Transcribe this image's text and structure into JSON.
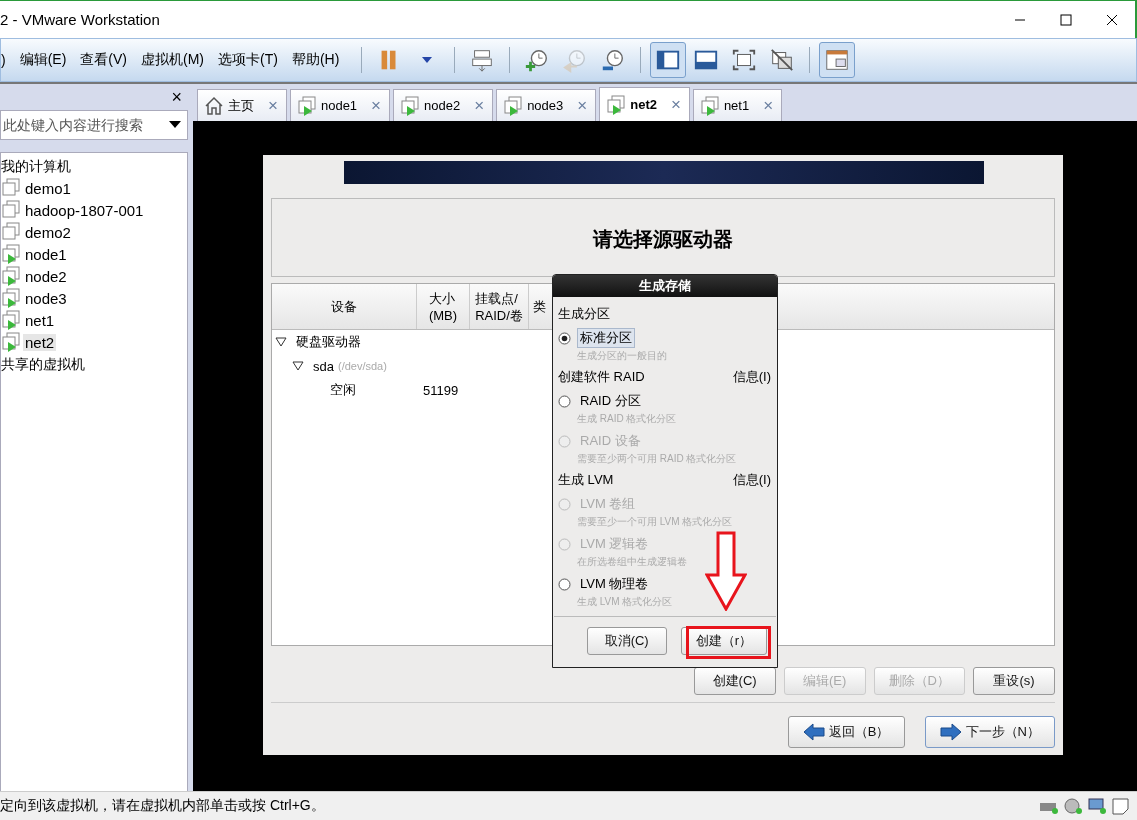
{
  "window": {
    "title": "2 - VMware Workstation"
  },
  "menu": [
    ")",
    "编辑(E)",
    "查看(V)",
    "虚拟机(M)",
    "选项卡(T)",
    "帮助(H)"
  ],
  "toolbar": [
    {
      "kind": "pause",
      "pressed": false,
      "disabled": false
    },
    {
      "kind": "caret",
      "pressed": false,
      "disabled": false
    },
    {
      "kind": "separator"
    },
    {
      "kind": "send-keys",
      "pressed": false,
      "disabled": false
    },
    {
      "kind": "separator"
    },
    {
      "kind": "snapshot",
      "pressed": false,
      "disabled": false
    },
    {
      "kind": "revert",
      "pressed": false,
      "disabled": true
    },
    {
      "kind": "snapshot-manager",
      "pressed": false,
      "disabled": false
    },
    {
      "kind": "separator"
    },
    {
      "kind": "library-view",
      "pressed": true,
      "disabled": false
    },
    {
      "kind": "console-view",
      "pressed": false,
      "disabled": false
    },
    {
      "kind": "fullscreen",
      "pressed": false,
      "disabled": false
    },
    {
      "kind": "unity",
      "pressed": false,
      "disabled": false
    },
    {
      "kind": "separator"
    },
    {
      "kind": "thumbnail-view",
      "pressed": true,
      "disabled": false
    }
  ],
  "sidebar": {
    "close": "×",
    "search": {
      "placeholder": "此处键入内容进行搜索"
    },
    "tree": [
      {
        "label": "我的计算机",
        "children": [
          {
            "label": "demo1",
            "running": false,
            "selected": false
          },
          {
            "label": "hadoop-1807-001",
            "running": false,
            "selected": false
          },
          {
            "label": "demo2",
            "running": false,
            "selected": false
          },
          {
            "label": "node1",
            "running": true,
            "selected": false
          },
          {
            "label": "node2",
            "running": true,
            "selected": false
          },
          {
            "label": "node3",
            "running": true,
            "selected": false
          },
          {
            "label": "net1",
            "running": true,
            "selected": false
          },
          {
            "label": "net2",
            "running": true,
            "selected": true
          }
        ]
      },
      {
        "label": "共享的虚拟机"
      }
    ]
  },
  "tabs": [
    {
      "label": "主页",
      "kind": "home",
      "selected": false,
      "close": "×"
    },
    {
      "label": "node1",
      "kind": "vm",
      "selected": false,
      "close": "×"
    },
    {
      "label": "node2",
      "kind": "vm",
      "selected": false,
      "close": "×"
    },
    {
      "label": "node3",
      "kind": "vm",
      "selected": false,
      "close": "×"
    },
    {
      "label": "net2",
      "kind": "vm",
      "selected": true,
      "close": "×"
    },
    {
      "label": "net1",
      "kind": "vm",
      "selected": false,
      "close": "×"
    }
  ],
  "installer": {
    "heading": "请选择源驱动器",
    "table": {
      "columns": [
        "设备",
        "大小\n(MB)",
        "挂载点/\nRAID/卷",
        "类"
      ],
      "rows": [
        {
          "device": "硬盘驱动器",
          "expanded": true,
          "children": [
            {
              "device": "sda",
              "path": "(/dev/sda)",
              "expanded": true,
              "children": [
                {
                  "device": "空闲",
                  "size": "51199"
                }
              ]
            }
          ]
        }
      ]
    },
    "actions": [
      {
        "label": "创建(C)",
        "disabled": false
      },
      {
        "label": "编辑(E)",
        "disabled": true
      },
      {
        "label": "删除（D）",
        "disabled": true
      },
      {
        "label": "重设(s)",
        "disabled": false
      }
    ],
    "nav": [
      {
        "label": "返回（B）",
        "kind": "back"
      },
      {
        "label": "下一步（N）",
        "kind": "next"
      }
    ]
  },
  "dialog": {
    "title": "生成存储",
    "items": [
      {
        "kind": "section",
        "label": "生成分区"
      },
      {
        "kind": "radio",
        "label": "标准分区",
        "description": "生成分区的一般目的",
        "selected": true,
        "disabled": false
      },
      {
        "kind": "section",
        "label": "创建软件 RAID",
        "info": "信息(I)"
      },
      {
        "kind": "radio",
        "label": "RAID 分区",
        "description": "生成 RAID 格式化分区",
        "selected": false,
        "disabled": false
      },
      {
        "kind": "radio",
        "label": "RAID 设备",
        "description": "需要至少两个可用 RAID 格式化分区",
        "selected": false,
        "disabled": true
      },
      {
        "kind": "section",
        "label": "生成 LVM",
        "info": "信息(I)"
      },
      {
        "kind": "radio",
        "label": "LVM 卷组",
        "description": "需要至少一个可用 LVM 格式化分区",
        "selected": false,
        "disabled": true
      },
      {
        "kind": "radio",
        "label": "LVM 逻辑卷",
        "description": "在所选卷组中生成逻辑卷",
        "selected": false,
        "disabled": true
      },
      {
        "kind": "radio",
        "label": "LVM 物理卷",
        "description": "生成 LVM 格式化分区",
        "selected": false,
        "disabled": false
      }
    ],
    "buttons": [
      "取消(C)",
      "创建（r）"
    ]
  },
  "status_bar": {
    "text": "定向到该虚拟机，请在虚拟机内部单击或按 Ctrl+G。"
  }
}
